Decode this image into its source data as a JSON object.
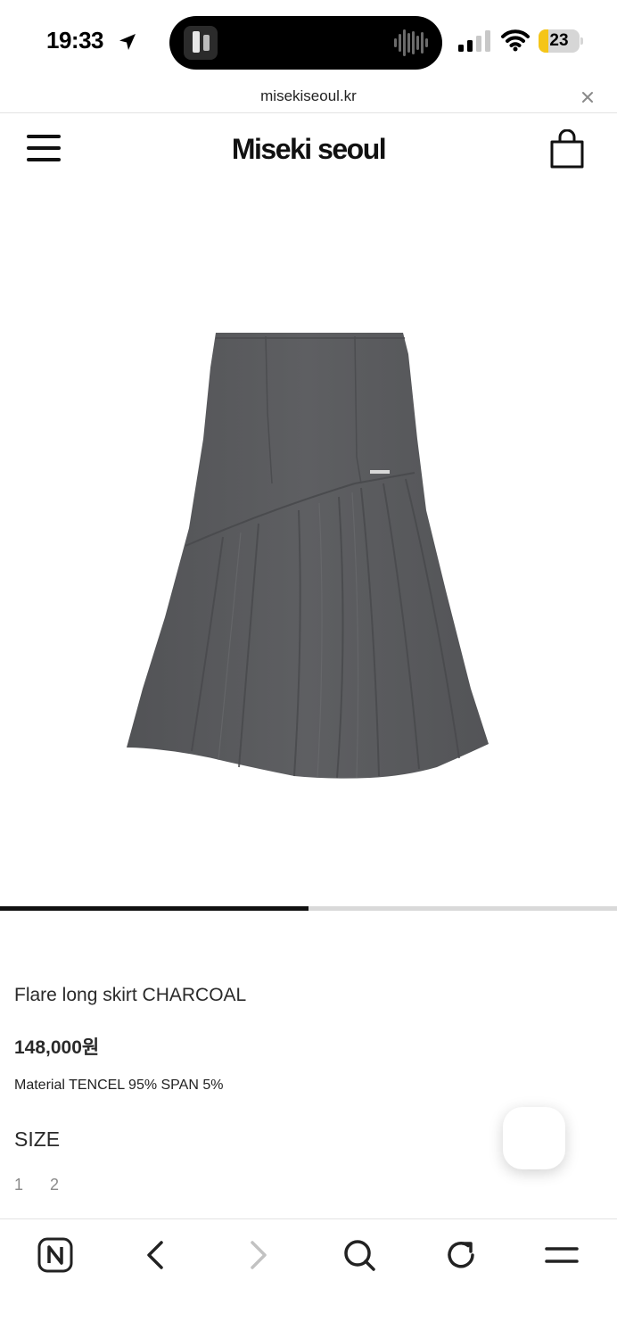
{
  "status_bar": {
    "time": "19:33",
    "battery_level": "23",
    "battery_fraction": 0.23,
    "battery_color": "#f5c518"
  },
  "browser": {
    "url": "misekiseoul.kr",
    "close_icon": "close-icon"
  },
  "header": {
    "brand": "Miseki seoul",
    "menu_icon": "hamburger-menu-icon",
    "cart_icon": "shopping-bag-icon"
  },
  "product": {
    "name": "Flare long skirt CHARCOAL",
    "price": "148,000원",
    "material": "Material TENCEL 95% SPAN 5%",
    "size_label": "SIZE",
    "sizes": [
      "1",
      "2"
    ],
    "gallery_progress": 0.5,
    "skirt_color": "#5c5d60"
  },
  "toolbar": {
    "icons": [
      "naver-home-icon",
      "back-icon",
      "forward-icon",
      "search-icon",
      "reload-icon",
      "menu-icon"
    ]
  }
}
